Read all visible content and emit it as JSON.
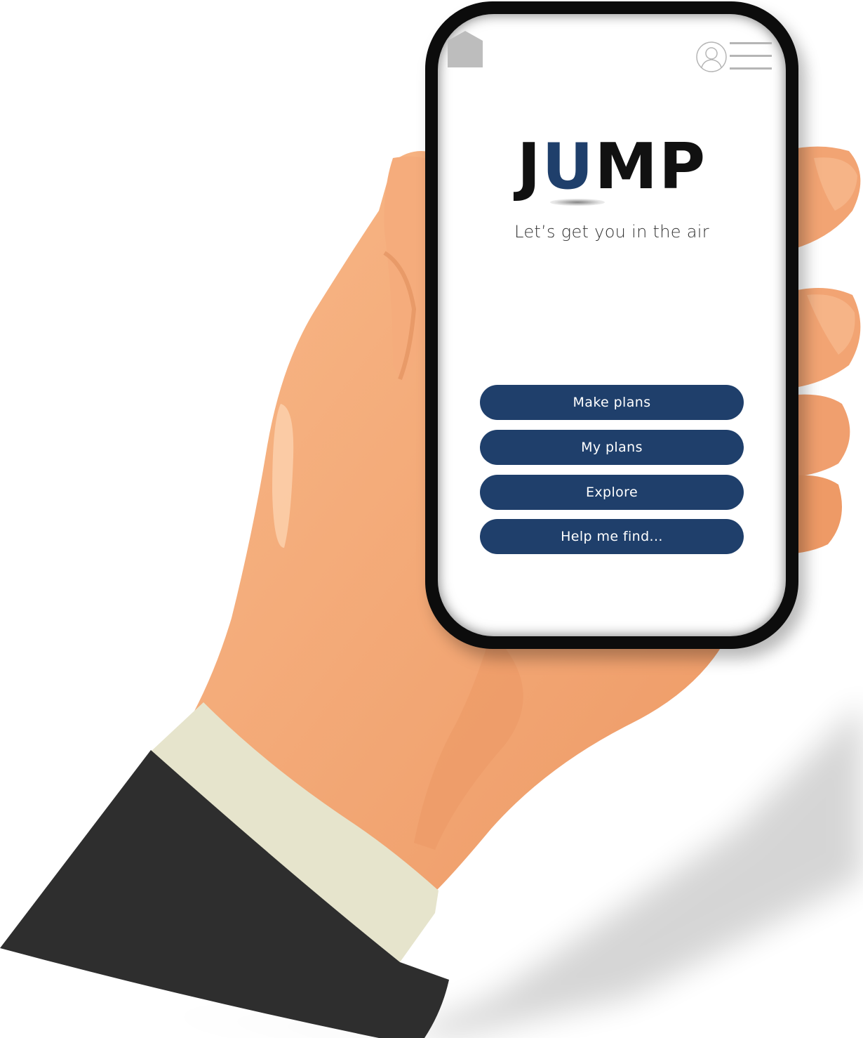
{
  "app": {
    "logo_parts": [
      "J",
      "U",
      "MP"
    ],
    "tagline": "Let’s get you in the air"
  },
  "header": {
    "home_icon": "home-icon",
    "profile_icon": "user-profile-icon",
    "menu_icon": "hamburger-menu-icon"
  },
  "menu": {
    "buttons": [
      {
        "label": "Make plans"
      },
      {
        "label": "My plans"
      },
      {
        "label": "Explore"
      },
      {
        "label": "Help me find..."
      }
    ]
  },
  "colors": {
    "brand_navy": "#1f3f6b",
    "logo_black": "#111111",
    "skin": "#f5a878",
    "cuff": "#e6e4cc",
    "sleeve": "#2e2e2e"
  }
}
